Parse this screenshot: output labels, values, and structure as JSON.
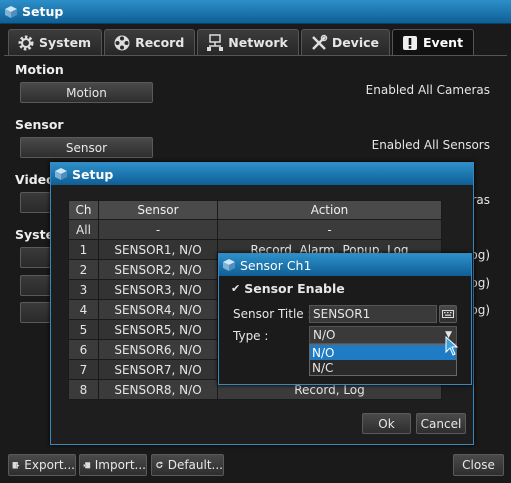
{
  "window": {
    "title": "Setup",
    "icon": "cube-icon"
  },
  "tabs": [
    {
      "label": "System",
      "icon": "gear-icon"
    },
    {
      "label": "Record",
      "icon": "film-reel-icon"
    },
    {
      "label": "Network",
      "icon": "network-icon"
    },
    {
      "label": "Device",
      "icon": "tools-icon"
    },
    {
      "label": "Event",
      "icon": "exclamation-icon",
      "active": true
    }
  ],
  "sections": {
    "motion": {
      "label": "Motion",
      "button": "Motion",
      "status": "Enabled All Cameras"
    },
    "sensor": {
      "label": "Sensor",
      "button": "Sensor",
      "status": "Enabled All Sensors"
    },
    "video": {
      "label": "Video",
      "status_partial": "ras"
    },
    "system": {
      "label": "Syster",
      "rows_partial": [
        "og)",
        "og)",
        "og)"
      ]
    }
  },
  "footer": {
    "export_label": "Export...",
    "import_label": "Import...",
    "default_label": "Default...",
    "close_label": "Close"
  },
  "sensor_dialog": {
    "title": "Setup",
    "columns": [
      "Ch",
      "Sensor",
      "Action"
    ],
    "rows": [
      {
        "ch": "All",
        "sensor": "-",
        "action": "-"
      },
      {
        "ch": "1",
        "sensor": "SENSOR1, N/O",
        "action": "Record, Alarm, Popup, Log"
      },
      {
        "ch": "2",
        "sensor": "SENSOR2, N/O",
        "action": ""
      },
      {
        "ch": "3",
        "sensor": "SENSOR3, N/O",
        "action": ""
      },
      {
        "ch": "4",
        "sensor": "SENSOR4, N/O",
        "action": ""
      },
      {
        "ch": "5",
        "sensor": "SENSOR5, N/O",
        "action": ""
      },
      {
        "ch": "6",
        "sensor": "SENSOR6, N/O",
        "action": ""
      },
      {
        "ch": "7",
        "sensor": "SENSOR7, N/O",
        "action": ""
      },
      {
        "ch": "8",
        "sensor": "SENSOR8, N/O",
        "action": "Record, Log"
      }
    ],
    "ok_label": "Ok",
    "cancel_label": "Cancel"
  },
  "sensor_ch_dialog": {
    "title": "Sensor Ch1",
    "enable_label": "Sensor Enable",
    "enable_checked": true,
    "title_field_label": "Sensor Title :",
    "title_field_value": "SENSOR1",
    "type_label": "Type :",
    "type_value": "N/O",
    "type_options": [
      "N/O",
      "N/C"
    ],
    "type_selected": "N/O"
  }
}
